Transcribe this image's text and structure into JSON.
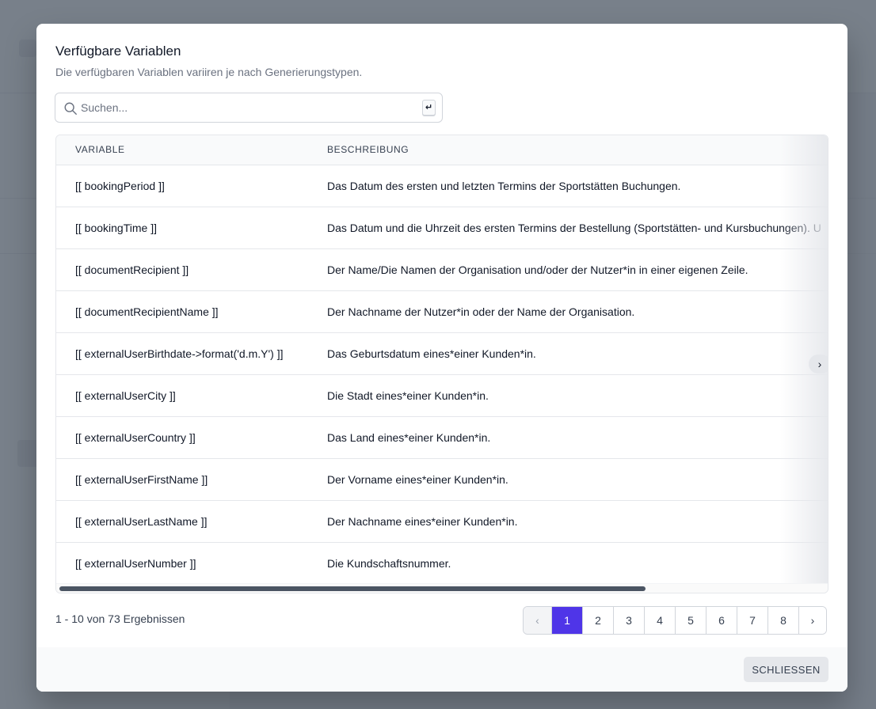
{
  "modal": {
    "title": "Verfügbare Variablen",
    "subtitle": "Die verfügbaren Variablen variiren je nach Generierungstypen.",
    "search_placeholder": "Suchen...",
    "enter_key": "↵"
  },
  "table": {
    "headers": {
      "variable": "VARIABLE",
      "description": "BESCHREIBUNG"
    },
    "rows": [
      {
        "variable": "[[ bookingPeriod ]]",
        "description": "Das Datum des ersten und letzten Termins der Sportstätten Buchungen."
      },
      {
        "variable": "[[ bookingTime ]]",
        "description": "Das Datum und die Uhrzeit des ersten Termins der Bestellung (Sportstätten- und Kursbuchungen). U"
      },
      {
        "variable": "[[ documentRecipient ]]",
        "description": "Der Name/Die Namen der Organisation und/oder der Nutzer*in in einer eigenen Zeile."
      },
      {
        "variable": "[[ documentRecipientName ]]",
        "description": "Der Nachname der Nutzer*in oder der Name der Organisation."
      },
      {
        "variable": "[[ externalUserBirthdate->format('d.m.Y') ]]",
        "description": "Das Geburtsdatum eines*einer Kunden*in."
      },
      {
        "variable": "[[ externalUserCity ]]",
        "description": "Die Stadt eines*einer Kunden*in."
      },
      {
        "variable": "[[ externalUserCountry ]]",
        "description": "Das Land eines*einer Kunden*in."
      },
      {
        "variable": "[[ externalUserFirstName ]]",
        "description": "Der Vorname eines*einer Kunden*in."
      },
      {
        "variable": "[[ externalUserLastName ]]",
        "description": "Der Nachname eines*einer Kunden*in."
      },
      {
        "variable": "[[ externalUserNumber ]]",
        "description": "Die Kundschaftsnummer."
      }
    ],
    "scroll_right": "›"
  },
  "pagination": {
    "results_text": "1 - 10 von 73 Ergebnissen",
    "prev": "‹",
    "next": "›",
    "pages": [
      "1",
      "2",
      "3",
      "4",
      "5",
      "6",
      "7",
      "8"
    ],
    "current": "1"
  },
  "footer": {
    "close_label": "SCHLIESSEN"
  },
  "colors": {
    "accent": "#4f35e8",
    "overlay": "#4b5563"
  }
}
